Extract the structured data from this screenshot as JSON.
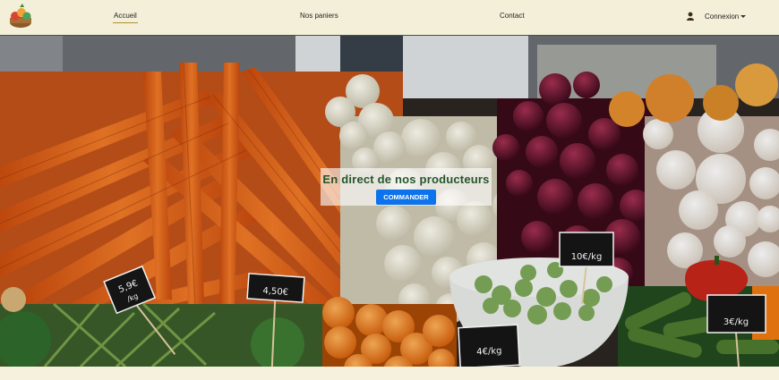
{
  "nav": {
    "home": "Accueil",
    "baskets": "Nos paniers",
    "contact": "Contact",
    "account": "Connexion",
    "icons": {
      "logo": "produce-basket-logo",
      "user": "user-icon",
      "caret": "chevron-down-icon"
    }
  },
  "hero": {
    "title": "En direct de nos producteurs",
    "button": "COMMANDER"
  },
  "signs": [
    {
      "line1": "5,9€",
      "line2": "/kg"
    },
    {
      "line1": "4,50€",
      "line2": ""
    },
    {
      "line1": "10€",
      "line2": "/kg"
    },
    {
      "line1": "4€",
      "line2": "/kg"
    },
    {
      "line1": "3€",
      "line2": "/kg"
    }
  ],
  "colors": {
    "accent": "#0d73ec",
    "brand": "#24552c",
    "navbar": "#f4efd9"
  }
}
